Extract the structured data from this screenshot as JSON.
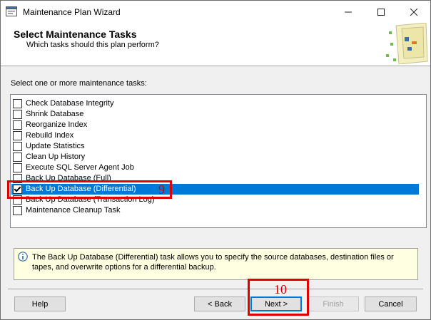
{
  "window": {
    "title": "Maintenance Plan Wizard"
  },
  "titlebar_buttons": {
    "minimize": "—",
    "maximize": "☐",
    "close": "✕"
  },
  "header": {
    "title": "Select Maintenance Tasks",
    "subtitle": "Which tasks should this plan perform?"
  },
  "prompt": "Select one or more maintenance tasks:",
  "tasks": [
    {
      "label": "Check Database Integrity",
      "checked": false
    },
    {
      "label": "Shrink Database",
      "checked": false
    },
    {
      "label": "Reorganize Index",
      "checked": false
    },
    {
      "label": "Rebuild Index",
      "checked": false
    },
    {
      "label": "Update Statistics",
      "checked": false
    },
    {
      "label": "Clean Up History",
      "checked": false
    },
    {
      "label": "Execute SQL Server Agent Job",
      "checked": false
    },
    {
      "label": "Back Up Database (Full)",
      "checked": false
    },
    {
      "label": "Back Up Database (Differential)",
      "checked": true
    },
    {
      "label": "Back Up Database (Transaction Log)",
      "checked": false
    },
    {
      "label": "Maintenance Cleanup Task",
      "checked": false
    }
  ],
  "selected_index": 8,
  "info": {
    "text": "The Back Up Database (Differential) task allows you to specify the source databases, destination files or tapes, and overwrite options for a differential backup."
  },
  "buttons": {
    "help": "Help",
    "back": "< Back",
    "next": "Next >",
    "finish": "Finish",
    "cancel": "Cancel"
  },
  "annotations": {
    "callout_9": "9",
    "callout_10": "10",
    "color": "#e00000"
  },
  "colors": {
    "selection": "#0078d7",
    "info_bg": "#ffffe1"
  }
}
